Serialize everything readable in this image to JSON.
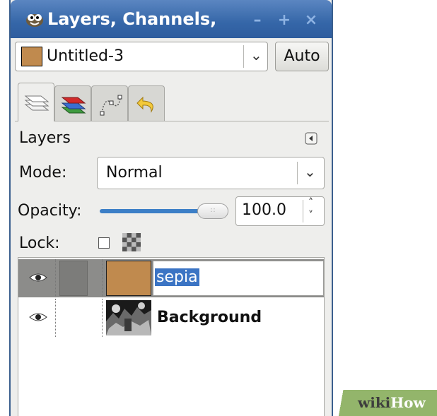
{
  "titlebar": {
    "title": "Layers, Channels,",
    "minimize_label": "–",
    "maximize_label": "+",
    "close_label": "×"
  },
  "image_selector": {
    "value": "Untitled-3",
    "swatch_color": "#c08a4e",
    "auto_label": "Auto"
  },
  "tabs": [
    {
      "name": "layers-tab",
      "icon": "layers-icon",
      "active": true
    },
    {
      "name": "channels-tab",
      "icon": "channels-icon",
      "active": false
    },
    {
      "name": "paths-tab",
      "icon": "paths-icon",
      "active": false
    },
    {
      "name": "undo-history-tab",
      "icon": "undo-icon",
      "active": false
    }
  ],
  "panel": {
    "title": "Layers",
    "mode_label": "Mode:",
    "mode_value": "Normal",
    "opacity_label": "Opacity:",
    "opacity_value": "100.0",
    "opacity_fraction": 1.0,
    "lock_label": "Lock:"
  },
  "layers": [
    {
      "name": "sepia",
      "selected": true,
      "thumb_color": "#c08a4e"
    },
    {
      "name": "Background",
      "selected": false
    }
  ],
  "watermark": {
    "wiki": "wiki",
    "how": "How"
  },
  "colors": {
    "titlebar": "#3566a8",
    "selection": "#3b74c4",
    "slider": "#3c7fc7",
    "sepia": "#c08a4e"
  }
}
